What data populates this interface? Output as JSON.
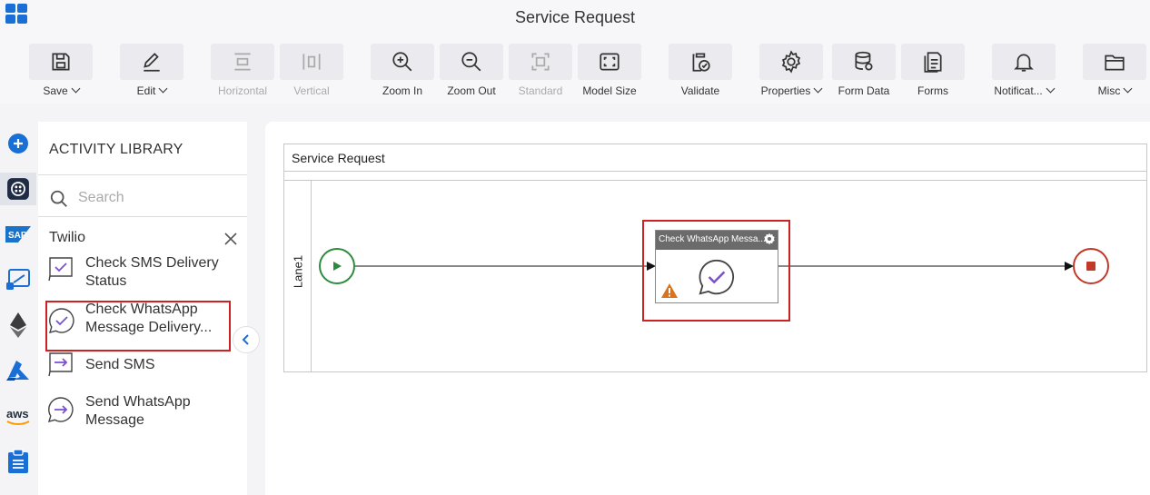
{
  "window": {
    "title": "Service Request"
  },
  "toolbar": {
    "save": "Save",
    "edit": "Edit",
    "horizontal": "Horizontal",
    "vertical": "Vertical",
    "zoom_in": "Zoom In",
    "zoom_out": "Zoom Out",
    "standard": "Standard",
    "model_size": "Model Size",
    "validate": "Validate",
    "properties": "Properties",
    "form_data": "Form Data",
    "forms": "Forms",
    "notifications": "Notificat...",
    "misc": "Misc"
  },
  "library": {
    "title": "ACTIVITY LIBRARY",
    "search_placeholder": "Search",
    "group": "Twilio",
    "items": [
      {
        "label": "Check SMS Delivery Status"
      },
      {
        "label": "Check WhatsApp Message Delivery..."
      },
      {
        "label": "Send SMS"
      },
      {
        "label": "Send WhatsApp Message"
      }
    ]
  },
  "rail": {
    "sap": "SAP",
    "aws": "aws"
  },
  "canvas": {
    "pool_title": "Service Request",
    "lane": "Lane1",
    "task_title": "Check WhatsApp Messa..."
  },
  "colors": {
    "accent": "#1a6fd6",
    "selection": "#cc2222",
    "start": "#2e8b3e",
    "end": "#c0392b",
    "activity_icon": "#7b4fd1",
    "warning": "#d9731f"
  }
}
